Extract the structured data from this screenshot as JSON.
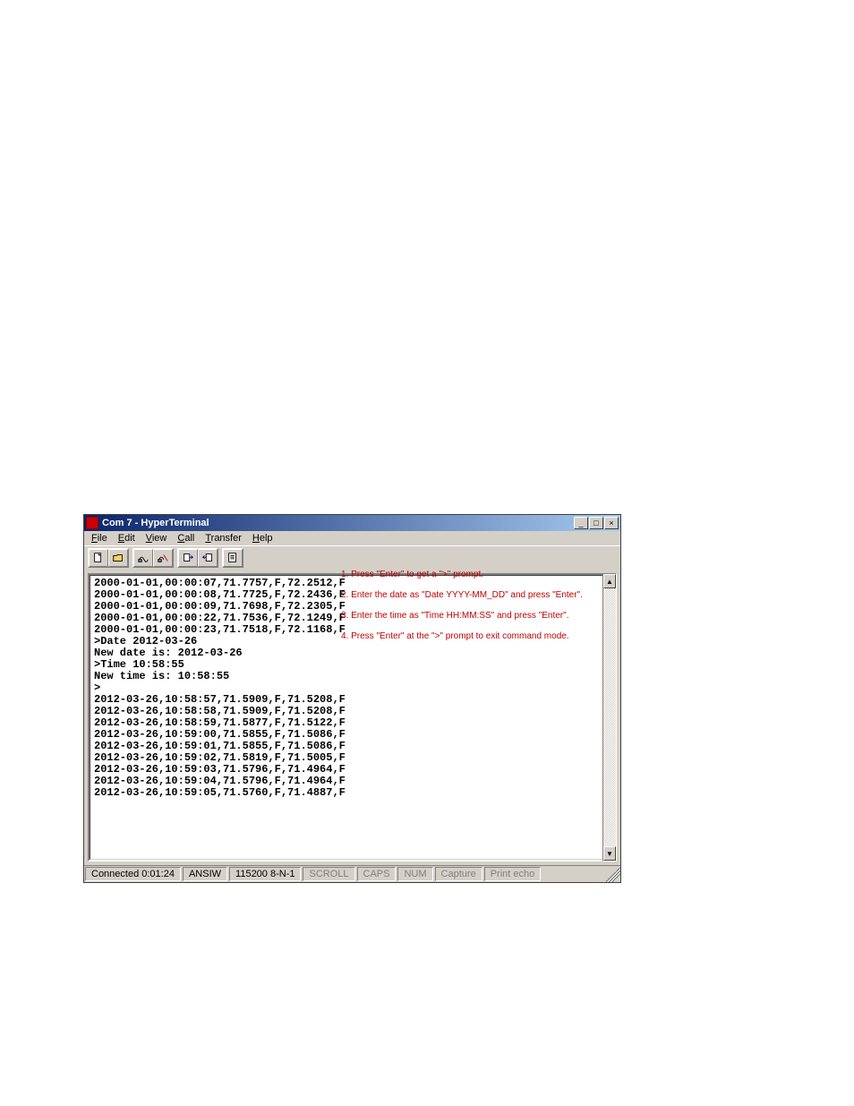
{
  "window": {
    "title": "Com 7 - HyperTerminal",
    "minimize": "_",
    "maximize": "□",
    "close": "×"
  },
  "menu": {
    "file": "File",
    "edit": "Edit",
    "view": "View",
    "call": "Call",
    "transfer": "Transfer",
    "help": "Help"
  },
  "terminal": {
    "lines": [
      "2000-01-01,00:00:07,71.7757,F,72.2512,F",
      "2000-01-01,00:00:08,71.7725,F,72.2436,F",
      "2000-01-01,00:00:09,71.7698,F,72.2305,F",
      "2000-01-01,00:00:22,71.7536,F,72.1249,F",
      "2000-01-01,00:00:23,71.7518,F,72.1168,F",
      ">Date 2012-03-26",
      "New date is: 2012-03-26",
      ">Time 10:58:55",
      "New time is: 10:58:55",
      ">",
      "2012-03-26,10:58:57,71.5909,F,71.5208,F",
      "2012-03-26,10:58:58,71.5909,F,71.5208,F",
      "2012-03-26,10:58:59,71.5877,F,71.5122,F",
      "2012-03-26,10:59:00,71.5855,F,71.5086,F",
      "2012-03-26,10:59:01,71.5855,F,71.5086,F",
      "2012-03-26,10:59:02,71.5819,F,71.5005,F",
      "2012-03-26,10:59:03,71.5796,F,71.4964,F",
      "2012-03-26,10:59:04,71.5796,F,71.4964,F",
      "2012-03-26,10:59:05,71.5760,F,71.4887,F"
    ]
  },
  "status": {
    "connected": "Connected 0:01:24",
    "emulation": "ANSIW",
    "settings": "115200 8-N-1",
    "scroll": "SCROLL",
    "caps": "CAPS",
    "num": "NUM",
    "capture": "Capture",
    "echo": "Print echo"
  },
  "annotations": {
    "a1": "1. Press \"Enter\" to get a \">\" prompt.",
    "a2": "2. Enter the date as \"Date YYYY-MM_DD\" and press \"Enter\".",
    "a3": "3. Enter the time as \"Time HH:MM:SS\" and press \"Enter\".",
    "a4": "4. Press \"Enter\" at the \">\" prompt to exit command mode."
  }
}
